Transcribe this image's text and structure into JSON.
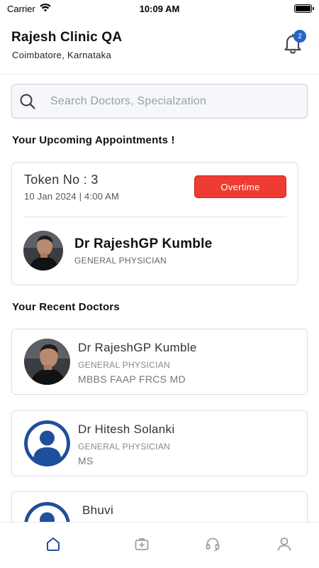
{
  "status_bar": {
    "carrier": "Carrier",
    "time": "10:09 AM"
  },
  "header": {
    "clinic_name": "Rajesh Clinic QA",
    "location": "Coimbatore, Karnataka",
    "notification_count": "2"
  },
  "search": {
    "placeholder": "Search Doctors, Specialzation",
    "value": ""
  },
  "upcoming": {
    "title": "Your Upcoming Appointments !",
    "appointment": {
      "token": "Token No : 3",
      "datetime": "10 Jan 2024 | 4:00 AM",
      "status_label": "Overtime",
      "doctor_name": "Dr RajeshGP Kumble",
      "specialization": "GENERAL PHYSICIAN"
    }
  },
  "recent": {
    "title": "Your Recent Doctors",
    "doctors": [
      {
        "name": "Dr RajeshGP Kumble",
        "specialization": "GENERAL PHYSICIAN",
        "degree": "MBBS FAAP FRCS MD",
        "avatar": "photo"
      },
      {
        "name": "Dr Hitesh Solanki",
        "specialization": "GENERAL PHYSICIAN",
        "degree": "MS",
        "avatar": "placeholder-user-icon"
      },
      {
        "name": "Bhuvi",
        "specialization": "",
        "degree": "",
        "avatar": "placeholder-user-icon"
      }
    ]
  },
  "tabbar": {
    "items": [
      {
        "icon": "home-icon",
        "active": true
      },
      {
        "icon": "medical-kit-icon",
        "active": false
      },
      {
        "icon": "headset-icon",
        "active": false
      },
      {
        "icon": "profile-icon",
        "active": false
      }
    ]
  },
  "colors": {
    "accent": "#1d4f9c",
    "overtime": "#ee3b33",
    "badge": "#2563c7",
    "inactive_icon": "#9aa0a8"
  }
}
